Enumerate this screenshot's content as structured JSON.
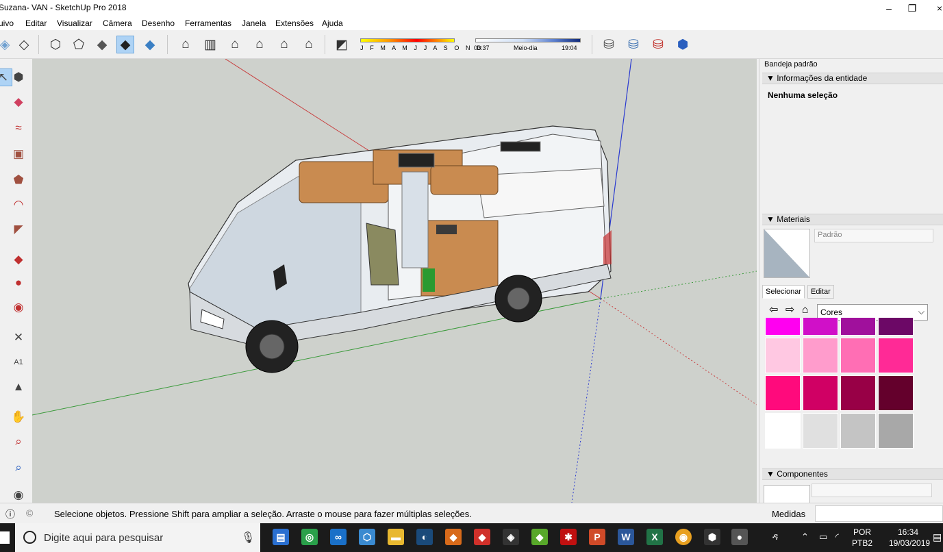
{
  "window": {
    "title": "Suzana- VAN - SketchUp Pro 2018",
    "minimize": "–",
    "restore": "❐",
    "close": "×"
  },
  "menu": [
    "uivo",
    "Editar",
    "Visualizar",
    "Câmera",
    "Desenho",
    "Ferramentas",
    "Janela",
    "Extensões",
    "Ajuda"
  ],
  "shadow": {
    "months": "J F M A M J J A S O N D",
    "time_start": "03:37",
    "time_mid": "Meio-dia",
    "time_end": "19:04"
  },
  "tray": {
    "title": "Bandeja padrão",
    "entity_info": {
      "header": "▼ Informações da entidade",
      "status": "Nenhuma seleção"
    },
    "materials": {
      "header": "▼ Materiais",
      "name": "Padrão",
      "tab_select": "Selecionar",
      "tab_edit": "Editar",
      "library": "Cores",
      "swatches": [
        "#ff00f0",
        "#d010c8",
        "#a0109c",
        "#6c0866",
        "#ffc8e2",
        "#ff9ccc",
        "#ff6eb4",
        "#ff2a96",
        "#ff0a7c",
        "#d00064",
        "#980046",
        "#64002c",
        "#ffffff",
        "#e0e0e0",
        "#c4c4c4",
        "#a8a8a8"
      ]
    },
    "components": {
      "header": "▼ Componentes"
    }
  },
  "status": {
    "message": "Selecione objetos. Pressione Shift para ampliar a seleção. Arraste o mouse para fazer múltiplas seleções.",
    "measurements_label": "Medidas"
  },
  "taskbar": {
    "search_placeholder": "Digite aqui para pesquisar",
    "lang1": "POR",
    "lang2": "PTB2",
    "time": "16:34",
    "date": "19/03/2019"
  }
}
